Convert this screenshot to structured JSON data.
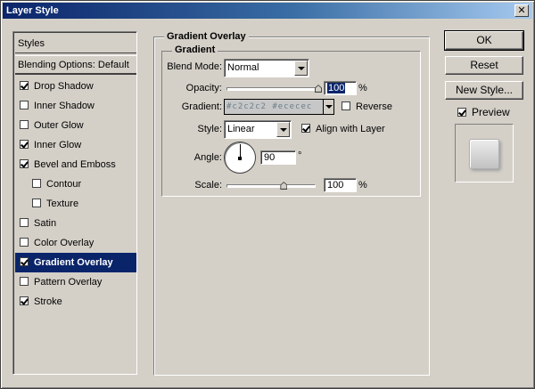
{
  "window": {
    "title": "Layer Style",
    "close_glyph": "✕"
  },
  "styles_panel": {
    "header": "Styles",
    "blending_default": "Blending Options: Default",
    "items": [
      {
        "label": "Drop Shadow",
        "checked": true,
        "sub": false
      },
      {
        "label": "Inner Shadow",
        "checked": false,
        "sub": false
      },
      {
        "label": "Outer Glow",
        "checked": false,
        "sub": false
      },
      {
        "label": "Inner Glow",
        "checked": true,
        "sub": false
      },
      {
        "label": "Bevel and Emboss",
        "checked": true,
        "sub": false
      },
      {
        "label": "Contour",
        "checked": false,
        "sub": true
      },
      {
        "label": "Texture",
        "checked": false,
        "sub": true
      },
      {
        "label": "Satin",
        "checked": false,
        "sub": false
      },
      {
        "label": "Color Overlay",
        "checked": false,
        "sub": false
      },
      {
        "label": "Gradient Overlay",
        "checked": true,
        "sub": false,
        "selected": true
      },
      {
        "label": "Pattern Overlay",
        "checked": false,
        "sub": false
      },
      {
        "label": "Stroke",
        "checked": true,
        "sub": false
      }
    ]
  },
  "gradient_overlay": {
    "group_title": "Gradient Overlay",
    "subgroup_title": "Gradient",
    "blend_mode": {
      "label": "Blend Mode:",
      "value": "Normal"
    },
    "opacity": {
      "label": "Opacity:",
      "value": "100",
      "unit": "%",
      "level": 100
    },
    "gradient": {
      "label": "Gradient:",
      "value": "#c2c2c2 #ececec",
      "reverse_label": "Reverse",
      "reverse_checked": false
    },
    "style": {
      "label": "Style:",
      "value": "Linear",
      "align_label": "Align with Layer",
      "align_checked": true
    },
    "angle": {
      "label": "Angle:",
      "value": "90",
      "unit": "°"
    },
    "scale": {
      "label": "Scale:",
      "value": "100",
      "unit": "%",
      "level": 100
    }
  },
  "buttons": {
    "ok": "OK",
    "reset": "Reset",
    "new_style": "New Style..."
  },
  "preview": {
    "label": "Preview",
    "checked": true
  },
  "colors": {
    "selection": "#0a246a",
    "face": "#d4d0c8",
    "gradient_start": "#c2c2c2",
    "gradient_end": "#ececec"
  }
}
